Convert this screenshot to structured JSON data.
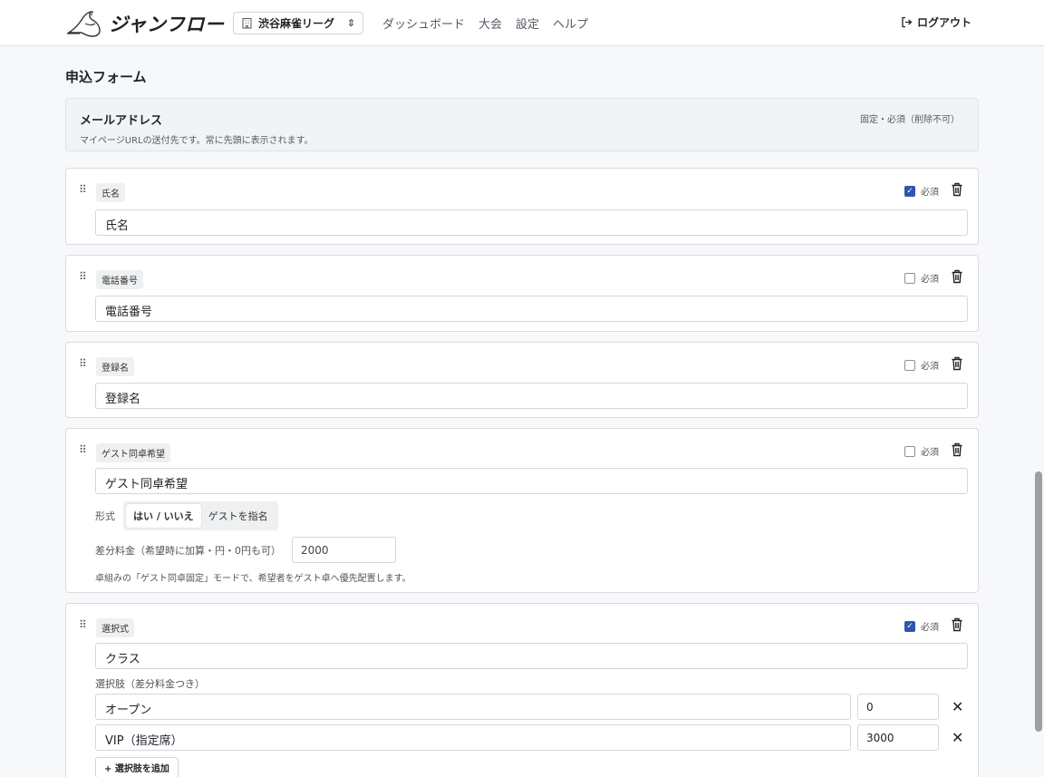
{
  "header": {
    "brand": "ジャンフロー",
    "org": "渋谷麻雀リーグ",
    "nav": [
      "ダッシュボード",
      "大会",
      "設定",
      "ヘルプ"
    ],
    "logout": "ログアウト"
  },
  "page_title": "申込フォーム",
  "email_field": {
    "title": "メールアドレス",
    "description": "マイページURLの送付先です。常に先頭に表示されます。",
    "fixed_note": "固定・必須（削除不可）"
  },
  "required_label": "必須",
  "fields": [
    {
      "type": "氏名",
      "label": "氏名",
      "required": true
    },
    {
      "type": "電話番号",
      "label": "電話番号",
      "required": false
    },
    {
      "type": "登録名",
      "label": "登録名",
      "required": false
    },
    {
      "type": "ゲスト同卓希望",
      "label": "ゲスト同卓希望",
      "required": false,
      "format_label": "形式",
      "format_options": [
        "はい / いいえ",
        "ゲストを指名"
      ],
      "format_selected": "はい / いいえ",
      "fee_label": "差分料金（希望時に加算・円・0円も可）",
      "fee_value": "2000",
      "note": "卓組みの「ゲスト同卓固定」モードで、希望者をゲスト卓へ優先配置します。"
    },
    {
      "type": "選択式",
      "label": "クラス",
      "required": true,
      "options_caption": "選択肢（差分料金つき）",
      "options": [
        {
          "label": "オープン",
          "fee": "0"
        },
        {
          "label": "VIP（指定席）",
          "fee": "3000"
        }
      ],
      "add_option": "+ 選択肢を追加"
    }
  ]
}
